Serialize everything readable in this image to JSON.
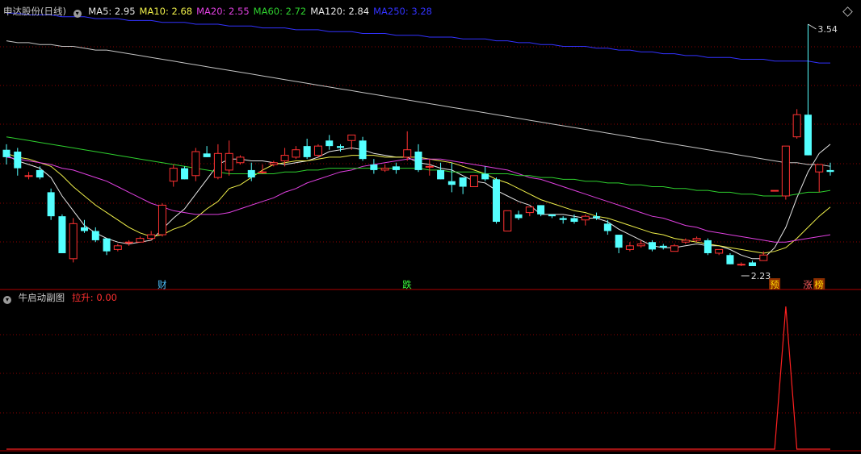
{
  "main_panel": {
    "stock_name": "申达股份",
    "period": "(日线)",
    "ma_values": [
      {
        "label": "MA5:",
        "value": "2.95",
        "color": "#e6e6e6"
      },
      {
        "label": "MA10:",
        "value": "2.68",
        "color": "#f0f04a"
      },
      {
        "label": "MA20:",
        "value": "2.55",
        "color": "#e040e0"
      },
      {
        "label": "MA60:",
        "value": "2.72",
        "color": "#2ed02e"
      },
      {
        "label": "MA120:",
        "value": "2.84",
        "color": "#e6e6e6"
      },
      {
        "label": "MA250:",
        "value": "3.28",
        "color": "#3232ff"
      }
    ],
    "high_label": "3.54",
    "low_label": "2.23",
    "markers": [
      {
        "text": "财",
        "color": "#4fc3ff",
        "bg": ""
      },
      {
        "text": "跌",
        "color": "#3cff3c",
        "bg": ""
      },
      {
        "text": "预",
        "color": "#ffd700",
        "bg": "#8b2e00"
      },
      {
        "text": "涨",
        "color": "#ff6060",
        "bg": ""
      },
      {
        "text": "榜",
        "color": "#ffd700",
        "bg": "#8b2e00"
      }
    ]
  },
  "sub_panel": {
    "title": "牛启动副图",
    "indicator_label": "拉升:",
    "indicator_value": "0.00"
  },
  "colors": {
    "up": "#ff3232",
    "down": "#54ffff",
    "grid": "#8b0000",
    "indicator": "#ff2020"
  },
  "chart_data": [
    {
      "type": "candlestick",
      "title": "申达股份(日线)",
      "ylim": [
        2.2,
        3.6
      ],
      "ohlc": [
        [
          2.86,
          2.82,
          2.89,
          2.78
        ],
        [
          2.85,
          2.76,
          2.87,
          2.72
        ],
        [
          2.72,
          2.72,
          2.74,
          2.7
        ],
        [
          2.75,
          2.71,
          2.77,
          2.7
        ],
        [
          2.63,
          2.5,
          2.65,
          2.48
        ],
        [
          2.5,
          2.3,
          2.51,
          2.3
        ],
        [
          2.27,
          2.46,
          2.49,
          2.25
        ],
        [
          2.44,
          2.42,
          2.48,
          2.41
        ],
        [
          2.42,
          2.37,
          2.44,
          2.36
        ],
        [
          2.38,
          2.31,
          2.38,
          2.29
        ],
        [
          2.32,
          2.34,
          2.35,
          2.31
        ],
        [
          2.36,
          2.36,
          2.37,
          2.34
        ],
        [
          2.36,
          2.38,
          2.39,
          2.36
        ],
        [
          2.38,
          2.4,
          2.42,
          2.37
        ],
        [
          2.4,
          2.56,
          2.57,
          2.39
        ],
        [
          2.69,
          2.76,
          2.78,
          2.66
        ],
        [
          2.76,
          2.7,
          2.77,
          2.7
        ],
        [
          2.72,
          2.85,
          2.87,
          2.69
        ],
        [
          2.84,
          2.82,
          2.88,
          2.82
        ],
        [
          2.71,
          2.84,
          2.89,
          2.7
        ],
        [
          2.75,
          2.84,
          2.91,
          2.72
        ],
        [
          2.79,
          2.82,
          2.83,
          2.78
        ],
        [
          2.75,
          2.71,
          2.79,
          2.69
        ],
        [
          2.74,
          2.74,
          2.78,
          2.73
        ],
        [
          2.78,
          2.79,
          2.8,
          2.77
        ],
        [
          2.8,
          2.83,
          2.87,
          2.77
        ],
        [
          2.82,
          2.86,
          2.88,
          2.81
        ],
        [
          2.88,
          2.82,
          2.92,
          2.81
        ],
        [
          2.83,
          2.88,
          2.89,
          2.82
        ],
        [
          2.91,
          2.88,
          2.94,
          2.86
        ],
        [
          2.88,
          2.87,
          2.89,
          2.85
        ],
        [
          2.91,
          2.94,
          2.94,
          2.86
        ],
        [
          2.91,
          2.81,
          2.93,
          2.8
        ],
        [
          2.78,
          2.75,
          2.81,
          2.73
        ],
        [
          2.75,
          2.76,
          2.78,
          2.74
        ],
        [
          2.77,
          2.75,
          2.79,
          2.73
        ],
        [
          2.82,
          2.86,
          2.96,
          2.8
        ],
        [
          2.85,
          2.75,
          2.89,
          2.74
        ],
        [
          2.77,
          2.77,
          2.81,
          2.72
        ],
        [
          2.75,
          2.7,
          2.79,
          2.7
        ],
        [
          2.69,
          2.67,
          2.79,
          2.63
        ],
        [
          2.71,
          2.66,
          2.71,
          2.62
        ],
        [
          2.66,
          2.72,
          2.72,
          2.66
        ],
        [
          2.73,
          2.7,
          2.77,
          2.69
        ],
        [
          2.7,
          2.47,
          2.71,
          2.46
        ],
        [
          2.42,
          2.53,
          2.53,
          2.42
        ],
        [
          2.51,
          2.49,
          2.53,
          2.48
        ],
        [
          2.52,
          2.55,
          2.55,
          2.5
        ],
        [
          2.56,
          2.51,
          2.56,
          2.5
        ],
        [
          2.51,
          2.5,
          2.51,
          2.49
        ],
        [
          2.49,
          2.48,
          2.5,
          2.46
        ],
        [
          2.49,
          2.47,
          2.51,
          2.46
        ],
        [
          2.48,
          2.5,
          2.51,
          2.45
        ],
        [
          2.5,
          2.49,
          2.52,
          2.48
        ],
        [
          2.46,
          2.42,
          2.48,
          2.4
        ],
        [
          2.4,
          2.33,
          2.4,
          2.3
        ],
        [
          2.32,
          2.34,
          2.36,
          2.31
        ],
        [
          2.34,
          2.35,
          2.37,
          2.33
        ],
        [
          2.36,
          2.32,
          2.37,
          2.31
        ],
        [
          2.34,
          2.33,
          2.35,
          2.32
        ],
        [
          2.31,
          2.34,
          2.35,
          2.31
        ],
        [
          2.36,
          2.37,
          2.38,
          2.35
        ],
        [
          2.37,
          2.38,
          2.39,
          2.36
        ],
        [
          2.37,
          2.3,
          2.38,
          2.29
        ],
        [
          2.3,
          2.32,
          2.32,
          2.29
        ],
        [
          2.29,
          2.24,
          2.3,
          2.24
        ],
        [
          2.24,
          2.24,
          2.25,
          2.23
        ],
        [
          2.25,
          2.23,
          2.26,
          2.23
        ],
        [
          2.26,
          2.29,
          2.31,
          2.26
        ],
        [
          2.64,
          2.64,
          2.64,
          2.64
        ],
        [
          2.61,
          2.88,
          2.88,
          2.59
        ],
        [
          2.93,
          3.05,
          3.08,
          2.92
        ],
        [
          3.05,
          2.83,
          3.54,
          2.83
        ],
        [
          2.74,
          2.78,
          2.78,
          2.63
        ],
        [
          2.75,
          2.74,
          2.79,
          2.72
        ]
      ],
      "ma": {
        "MA5": [
          2.83,
          2.8,
          2.78,
          2.76,
          2.71,
          2.61,
          2.53,
          2.45,
          2.41,
          2.38,
          2.36,
          2.35,
          2.36,
          2.37,
          2.43,
          2.49,
          2.54,
          2.62,
          2.7,
          2.78,
          2.81,
          2.81,
          2.8,
          2.8,
          2.79,
          2.78,
          2.79,
          2.8,
          2.82,
          2.85,
          2.86,
          2.87,
          2.86,
          2.84,
          2.83,
          2.82,
          2.82,
          2.79,
          2.78,
          2.76,
          2.75,
          2.72,
          2.69,
          2.68,
          2.64,
          2.61,
          2.58,
          2.56,
          2.51,
          2.51,
          2.51,
          2.5,
          2.49,
          2.49,
          2.47,
          2.43,
          2.4,
          2.37,
          2.34,
          2.33,
          2.33,
          2.34,
          2.35,
          2.34,
          2.34,
          2.32,
          2.29,
          2.27,
          2.27,
          2.33,
          2.44,
          2.6,
          2.74,
          2.84,
          2.89
        ],
        "MA10": [
          2.84,
          2.82,
          2.81,
          2.79,
          2.77,
          2.72,
          2.66,
          2.61,
          2.56,
          2.52,
          2.48,
          2.44,
          2.41,
          2.39,
          2.4,
          2.43,
          2.45,
          2.49,
          2.54,
          2.58,
          2.65,
          2.67,
          2.71,
          2.75,
          2.78,
          2.79,
          2.8,
          2.8,
          2.81,
          2.82,
          2.82,
          2.83,
          2.83,
          2.83,
          2.82,
          2.82,
          2.82,
          2.82,
          2.81,
          2.8,
          2.79,
          2.77,
          2.75,
          2.73,
          2.7,
          2.68,
          2.65,
          2.62,
          2.59,
          2.57,
          2.55,
          2.53,
          2.52,
          2.5,
          2.49,
          2.47,
          2.45,
          2.43,
          2.41,
          2.4,
          2.38,
          2.37,
          2.36,
          2.35,
          2.34,
          2.33,
          2.32,
          2.31,
          2.3,
          2.31,
          2.33,
          2.38,
          2.44,
          2.5,
          2.55
        ],
        "MA20": [
          2.82,
          2.81,
          2.8,
          2.79,
          2.78,
          2.76,
          2.75,
          2.73,
          2.71,
          2.69,
          2.66,
          2.63,
          2.6,
          2.57,
          2.55,
          2.53,
          2.52,
          2.51,
          2.51,
          2.51,
          2.52,
          2.54,
          2.56,
          2.58,
          2.6,
          2.63,
          2.65,
          2.68,
          2.7,
          2.72,
          2.74,
          2.75,
          2.77,
          2.78,
          2.79,
          2.8,
          2.81,
          2.81,
          2.81,
          2.81,
          2.8,
          2.79,
          2.78,
          2.77,
          2.76,
          2.75,
          2.73,
          2.71,
          2.7,
          2.68,
          2.66,
          2.64,
          2.62,
          2.6,
          2.58,
          2.56,
          2.54,
          2.52,
          2.5,
          2.49,
          2.47,
          2.45,
          2.44,
          2.42,
          2.41,
          2.4,
          2.39,
          2.38,
          2.37,
          2.36,
          2.36,
          2.37,
          2.38,
          2.39,
          2.4
        ],
        "MA60": [
          2.93,
          2.92,
          2.91,
          2.9,
          2.89,
          2.88,
          2.87,
          2.86,
          2.85,
          2.84,
          2.83,
          2.82,
          2.81,
          2.8,
          2.79,
          2.78,
          2.77,
          2.76,
          2.75,
          2.74,
          2.73,
          2.73,
          2.73,
          2.73,
          2.73,
          2.74,
          2.74,
          2.75,
          2.75,
          2.76,
          2.76,
          2.76,
          2.76,
          2.76,
          2.76,
          2.76,
          2.76,
          2.76,
          2.75,
          2.75,
          2.74,
          2.74,
          2.74,
          2.73,
          2.73,
          2.73,
          2.72,
          2.72,
          2.71,
          2.71,
          2.7,
          2.7,
          2.69,
          2.69,
          2.68,
          2.68,
          2.67,
          2.67,
          2.66,
          2.66,
          2.65,
          2.65,
          2.64,
          2.64,
          2.63,
          2.63,
          2.62,
          2.62,
          2.61,
          2.61,
          2.61,
          2.62,
          2.63,
          2.63,
          2.64
        ],
        "MA120": [
          3.45,
          3.44,
          3.44,
          3.43,
          3.43,
          3.42,
          3.42,
          3.41,
          3.4,
          3.4,
          3.39,
          3.38,
          3.37,
          3.36,
          3.35,
          3.34,
          3.33,
          3.32,
          3.31,
          3.3,
          3.29,
          3.28,
          3.27,
          3.26,
          3.25,
          3.24,
          3.23,
          3.22,
          3.21,
          3.2,
          3.19,
          3.18,
          3.17,
          3.16,
          3.15,
          3.14,
          3.13,
          3.12,
          3.11,
          3.1,
          3.09,
          3.08,
          3.07,
          3.06,
          3.05,
          3.04,
          3.03,
          3.02,
          3.01,
          3.0,
          2.99,
          2.98,
          2.97,
          2.96,
          2.95,
          2.94,
          2.93,
          2.92,
          2.91,
          2.9,
          2.89,
          2.88,
          2.87,
          2.86,
          2.85,
          2.84,
          2.83,
          2.82,
          2.81,
          2.8,
          2.79,
          2.79,
          2.78,
          2.78,
          2.77
        ],
        "MA250": [
          3.6,
          3.6,
          3.59,
          3.59,
          3.59,
          3.58,
          3.58,
          3.58,
          3.57,
          3.57,
          3.57,
          3.56,
          3.56,
          3.56,
          3.55,
          3.55,
          3.55,
          3.54,
          3.54,
          3.54,
          3.53,
          3.53,
          3.53,
          3.52,
          3.52,
          3.52,
          3.51,
          3.51,
          3.51,
          3.5,
          3.5,
          3.5,
          3.49,
          3.49,
          3.49,
          3.48,
          3.48,
          3.48,
          3.47,
          3.47,
          3.47,
          3.46,
          3.46,
          3.46,
          3.45,
          3.45,
          3.44,
          3.44,
          3.43,
          3.43,
          3.42,
          3.42,
          3.42,
          3.41,
          3.41,
          3.4,
          3.4,
          3.39,
          3.39,
          3.38,
          3.38,
          3.37,
          3.37,
          3.36,
          3.36,
          3.36,
          3.35,
          3.35,
          3.35,
          3.34,
          3.34,
          3.34,
          3.34,
          3.33,
          3.33
        ]
      },
      "high": {
        "index": 72,
        "value": 3.54
      },
      "low": {
        "index": 66,
        "value": 2.23
      },
      "markers": [
        {
          "index": 14,
          "text": "财"
        },
        {
          "index": 36,
          "text": "跌"
        },
        {
          "index": 69,
          "text": "预"
        },
        {
          "index": 72,
          "text": "涨"
        },
        {
          "index": 73,
          "text": "榜"
        }
      ]
    },
    {
      "type": "line",
      "title": "牛启动副图",
      "series": [
        {
          "name": "拉升",
          "values": [
            0,
            0,
            0,
            0,
            0,
            0,
            0,
            0,
            0,
            0,
            0,
            0,
            0,
            0,
            0,
            0,
            0,
            0,
            0,
            0,
            0,
            0,
            0,
            0,
            0,
            0,
            0,
            0,
            0,
            0,
            0,
            0,
            0,
            0,
            0,
            0,
            0,
            0,
            0,
            0,
            0,
            0,
            0,
            0,
            0,
            0,
            0,
            0,
            0,
            0,
            0,
            0,
            0,
            0,
            0,
            0,
            0,
            0,
            0,
            0,
            0,
            0,
            0,
            0,
            0,
            0,
            0,
            0,
            0,
            0,
            1,
            0,
            0,
            0,
            0
          ]
        }
      ],
      "ylim": [
        0,
        1
      ]
    }
  ]
}
